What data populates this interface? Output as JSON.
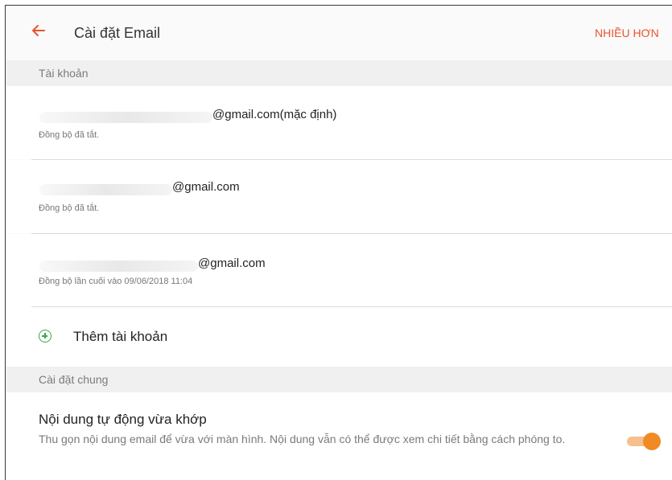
{
  "header": {
    "title": "Cài đặt Email",
    "more_label": "NHIỀU HƠN"
  },
  "sections": {
    "accounts": "Tài khoản",
    "general": "Cài đặt chung"
  },
  "accounts": [
    {
      "email": "@gmail.com(mặc định)",
      "status": "Đồng bộ đã tắt."
    },
    {
      "email": "@gmail.com",
      "status": "Đồng bộ đã tắt."
    },
    {
      "email": "@gmail.com",
      "status": "Đồng bộ lần cuối vào 09/06/2018  11:04"
    }
  ],
  "add_account": {
    "label": "Thêm tài khoản"
  },
  "auto_fit": {
    "title": "Nội dung tự động vừa khớp",
    "description": "Thu gọn nội dung email để vừa với màn hình. Nội dung vẫn có thể được xem chi tiết bằng cách phóng to.",
    "enabled": true
  },
  "colors": {
    "accent": "#e8542e",
    "toggle": "#f08a24",
    "add_icon": "#3aa64b"
  },
  "icons": {
    "back": "arrow-left-icon",
    "add": "plus-circle-icon"
  }
}
